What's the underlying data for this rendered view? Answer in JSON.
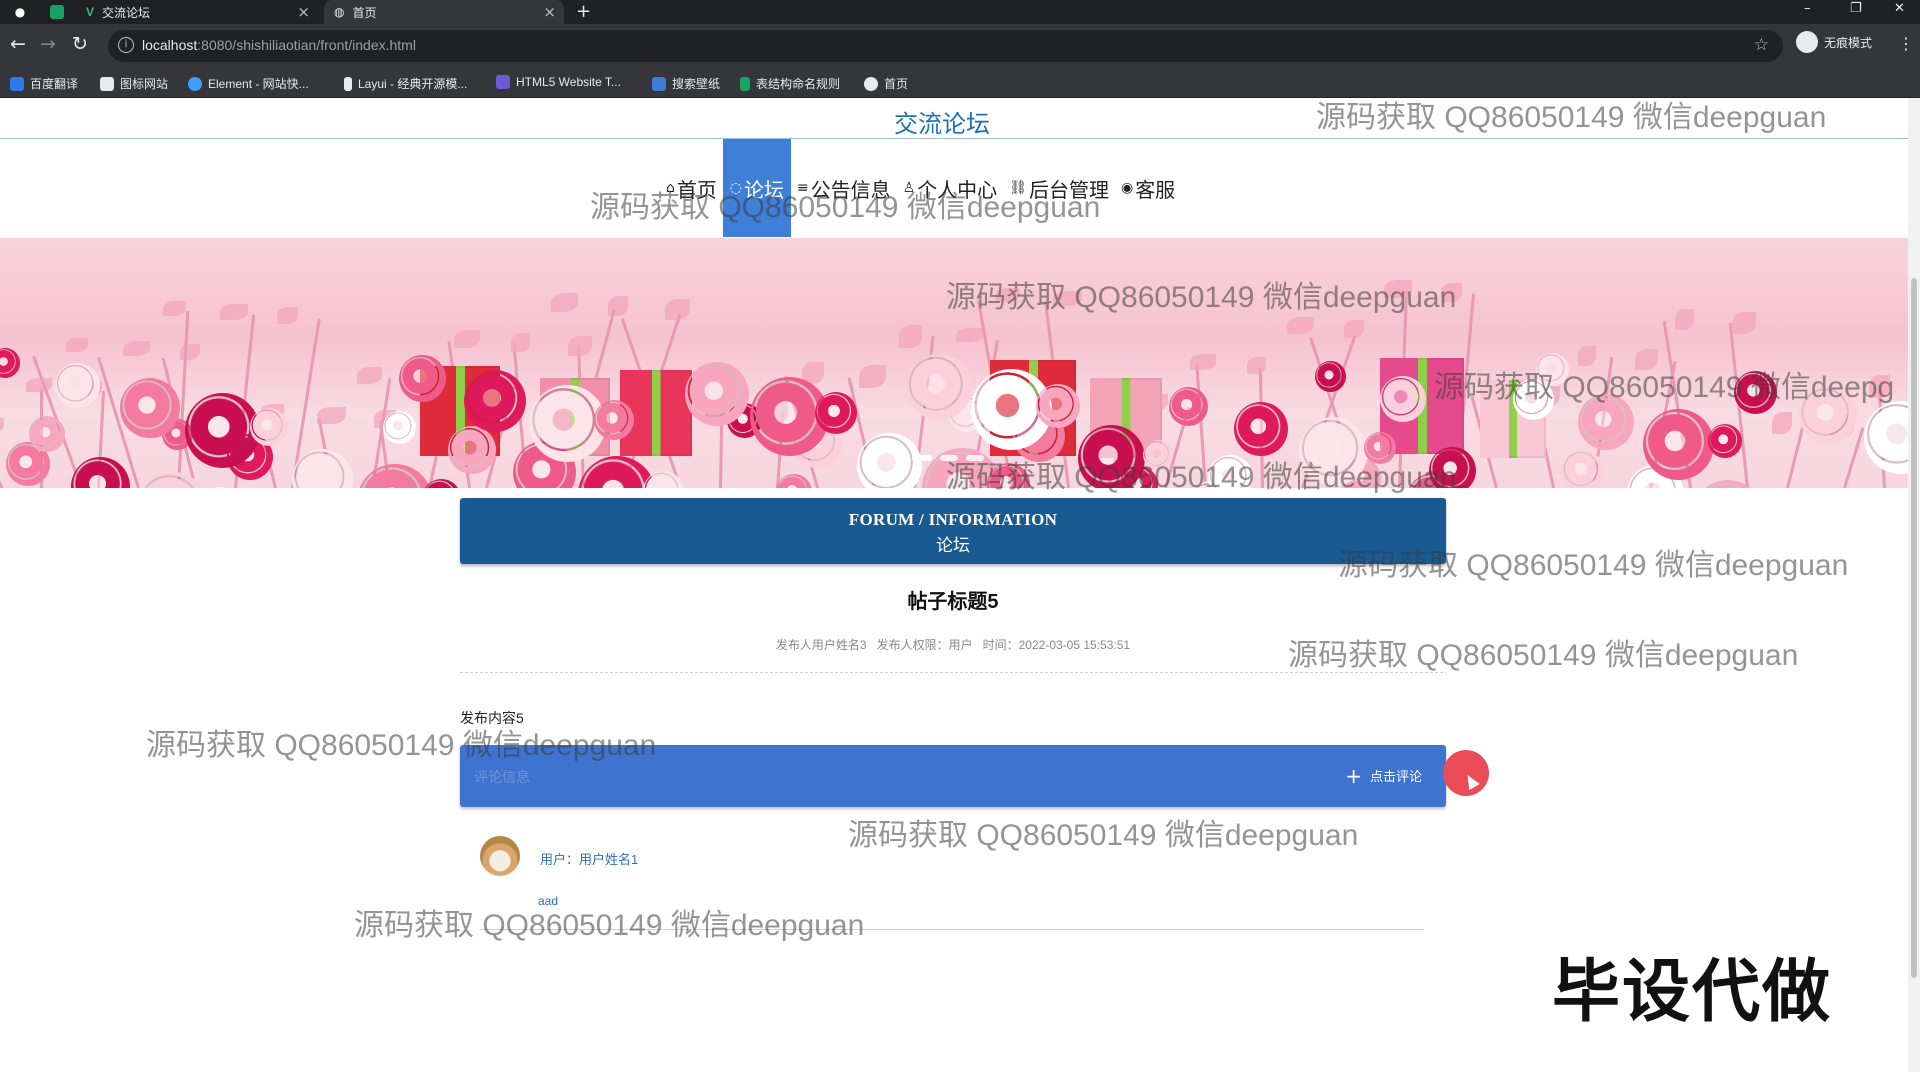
{
  "browser": {
    "tabs": [
      {
        "title": "交流论坛",
        "active": false
      },
      {
        "title": "首页",
        "active": true
      }
    ],
    "url_host": "localhost",
    "url_path": ":8080/shishiliaotian/front/index.html",
    "incognito_label": "无痕模式",
    "bookmarks": [
      {
        "label": "百度翻译",
        "color": "#2d7be5"
      },
      {
        "label": "图标网站",
        "color": "#e8eaed"
      },
      {
        "label": "Element - 网站快...",
        "color": "#409eff"
      },
      {
        "label": "Layui - 经典开源模...",
        "color": "#e8eaed"
      },
      {
        "label": "HTML5 Website T...",
        "color": "#6b5bd6"
      },
      {
        "label": "搜索壁纸",
        "color": "#3f7ad6"
      },
      {
        "label": "表结构命名规则",
        "color": "#1aa260"
      },
      {
        "label": "首页",
        "color": "#e8eaed"
      }
    ]
  },
  "site": {
    "title": "交流论坛",
    "nav": [
      {
        "label": "首页",
        "icon": "home-icon",
        "glyph": "⌂",
        "active": false
      },
      {
        "label": "论坛",
        "icon": "chat-icon",
        "glyph": "◌",
        "active": true
      },
      {
        "label": "公告信息",
        "icon": "list-icon",
        "glyph": "≡",
        "active": false
      },
      {
        "label": "个人中心",
        "icon": "user-icon",
        "glyph": "♙",
        "active": false
      },
      {
        "label": "后台管理",
        "icon": "link-icon",
        "glyph": "⛓",
        "active": false
      },
      {
        "label": "客服",
        "icon": "support-icon",
        "glyph": "◉",
        "active": false
      }
    ],
    "carousel_active_index": 0
  },
  "forum": {
    "header_en": "FORUM / INFORMATION",
    "header_cn": "论坛",
    "post_title": "帖子标题5",
    "meta": {
      "author": "发布人用户姓名3",
      "role": "发布人权限：用户",
      "time": "时间：2022-03-05 15:53:51"
    },
    "content": "发布内容5",
    "comment_bar_label": "评论信息",
    "comment_button": "点击评论",
    "comments": [
      {
        "user": "用户：用户姓名1",
        "text": "aad"
      }
    ]
  },
  "overlay": {
    "watermark": "源码获取 QQ86050149 微信deepguan",
    "watermark_cut": "源码获取 QQ86050149 微信deepg",
    "promo": "毕设代做"
  },
  "colors": {
    "brand_blue": "#1e6fb5",
    "nav_active": "#3f7fd8",
    "forum_header": "#1a5a93",
    "comment_bar": "#3e74cf"
  }
}
